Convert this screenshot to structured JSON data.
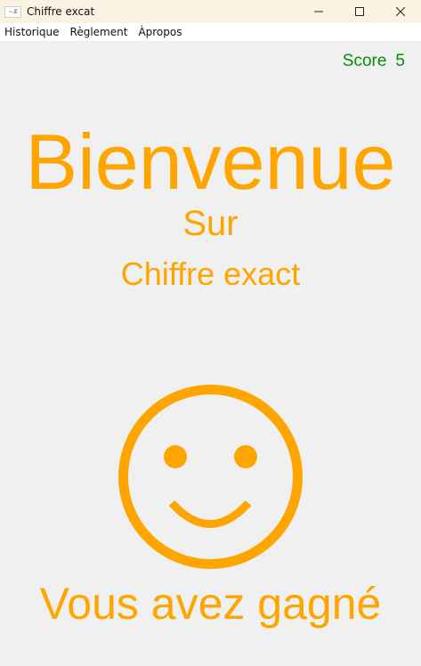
{
  "window": {
    "title": "Chiffre excat",
    "icon_text": "~.E"
  },
  "menu": {
    "items": [
      "Historique",
      "Règlement",
      "Àpropos"
    ]
  },
  "score": {
    "label": "Score",
    "value": "5"
  },
  "welcome": {
    "line1": "Bienvenue",
    "line2": "Sur",
    "line3": "Chiffre exact"
  },
  "result": {
    "message": "Vous avez gagné",
    "face": "smiley-icon"
  },
  "colors": {
    "accent": "#ffa500",
    "score": "#0a8a0a",
    "background": "#f0f0f0",
    "titlebar": "#fbf3e1"
  }
}
